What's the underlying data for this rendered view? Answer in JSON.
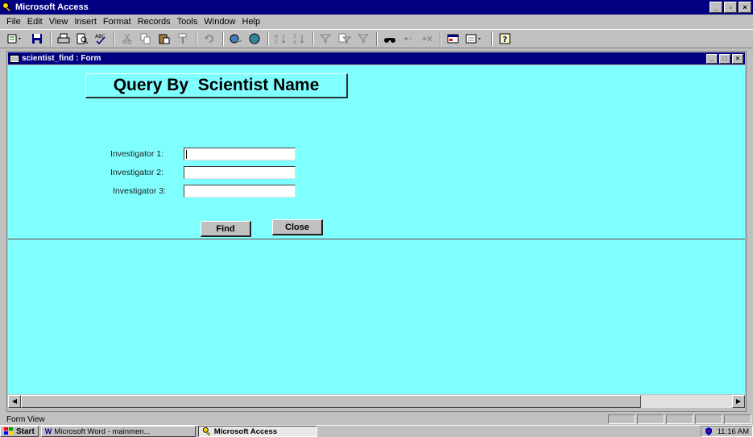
{
  "app": {
    "title": "Microsoft Access",
    "controls": {
      "minimize": "_",
      "restore": "▫",
      "close": "×"
    }
  },
  "menu": {
    "items": [
      {
        "label": "File"
      },
      {
        "label": "Edit"
      },
      {
        "label": "View"
      },
      {
        "label": "Insert"
      },
      {
        "label": "Format"
      },
      {
        "label": "Records"
      },
      {
        "label": "Tools"
      },
      {
        "label": "Window"
      },
      {
        "label": "Help"
      }
    ]
  },
  "toolbar": {
    "icons": [
      "view-icon",
      "save-icon",
      "print-icon",
      "print-preview-icon",
      "spelling-icon",
      "cut-icon",
      "copy-icon",
      "paste-icon",
      "format-painter-icon",
      "undo-icon",
      "insert-hyperlink-icon",
      "web-toolbar-icon",
      "sort-ascending-icon",
      "sort-descending-icon",
      "filter-by-selection-icon",
      "filter-by-form-icon",
      "apply-filter-icon",
      "find-icon",
      "new-record-icon",
      "delete-record-icon",
      "database-window-icon",
      "new-object-icon",
      "help-icon"
    ]
  },
  "form_window": {
    "title": "scientist_find : Form",
    "controls": {
      "minimize": "_",
      "restore": "□",
      "close": "×"
    },
    "heading": "Query By  Scientist Name",
    "fields": [
      {
        "label": "Investigator 1:",
        "value": ""
      },
      {
        "label": "Investigator 2:",
        "value": ""
      },
      {
        "label": "Investigator 3:",
        "value": ""
      }
    ],
    "buttons": {
      "find": "Find",
      "close": "Close"
    },
    "background_color": "#80ffff"
  },
  "status_bar": {
    "text": "Form View"
  },
  "taskbar": {
    "start": "Start",
    "tasks": [
      {
        "label": "Microsoft Word - mainmen...",
        "active": false
      },
      {
        "label": "Microsoft Access",
        "active": true
      }
    ],
    "clock": "11:16 AM"
  }
}
